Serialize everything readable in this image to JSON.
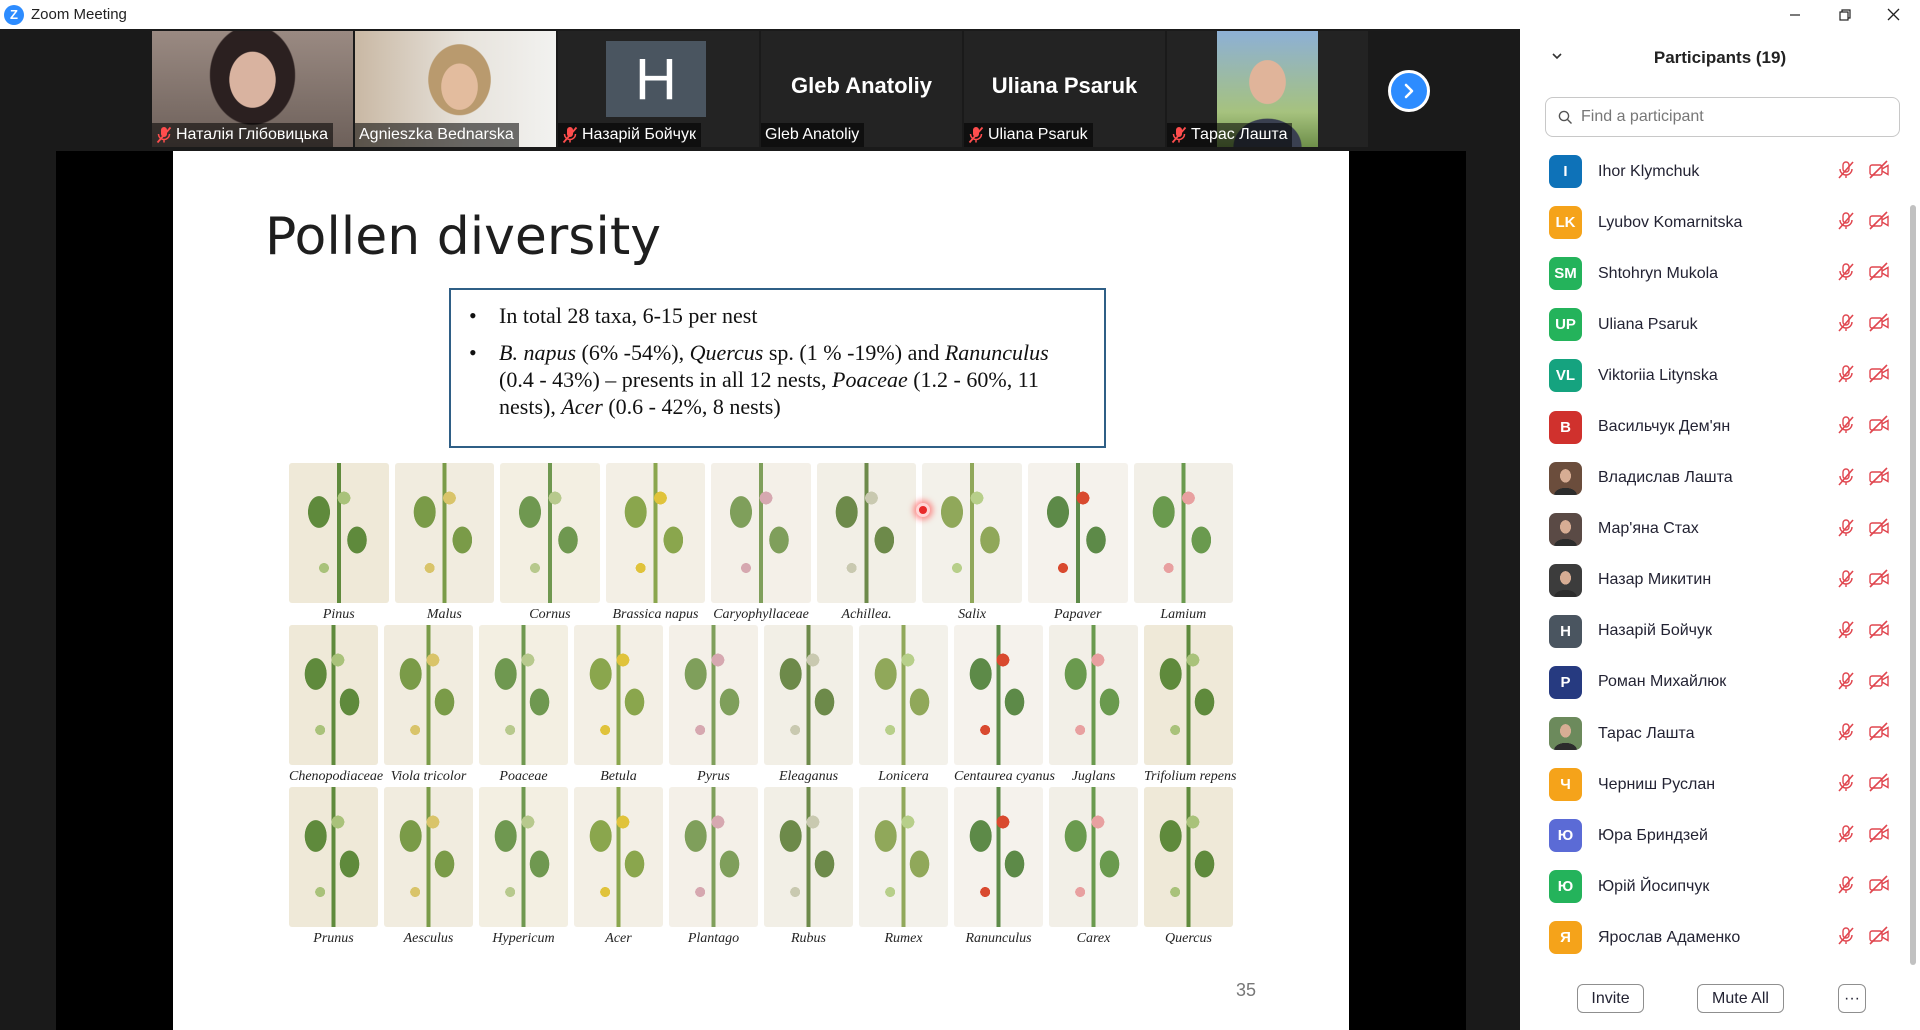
{
  "window": {
    "title": "Zoom Meeting"
  },
  "videos": [
    {
      "name": "Наталія Глібовицька",
      "muted": true,
      "kind": "photo"
    },
    {
      "name": "Agnieszka Bednarska",
      "muted": false,
      "kind": "photo",
      "active": true
    },
    {
      "name": "Назарій Бойчук",
      "muted": true,
      "kind": "avatar",
      "initial": "H"
    },
    {
      "name": "Gleb Anatoliy",
      "muted": false,
      "kind": "name",
      "display": "Gleb Anatoliy"
    },
    {
      "name": "Uliana Psaruk",
      "muted": true,
      "kind": "name",
      "display": "Uliana Psaruk"
    },
    {
      "name": "Тарас Лашта",
      "muted": true,
      "kind": "photo"
    }
  ],
  "slide": {
    "title": "Pollen diversity",
    "bullet1": "In total 28 taxa, 6-15 per nest",
    "b2_i1": "B. napus",
    "b2_t1": " (6% -54%), ",
    "b2_i2": "Quercus",
    "b2_t2": " sp. (1 % -19%) and ",
    "b2_i3": "Ranunculus",
    "b2_t3": " (0.4 - 43%) – presents in all 12 nests, ",
    "b2_i4": "Poaceae",
    "b2_t4": " (1.2 - 60%, 11 nests), ",
    "b2_i5": "Acer",
    "b2_t5": " (0.6 - 42%, 8 nests)",
    "page_number": "35",
    "plants_row1": [
      "Pinus",
      "Malus",
      "Cornus",
      "Brassica napus",
      "Caryophyllaceae",
      "Achillea.",
      "Salix",
      "Papaver",
      "Lamium"
    ],
    "plants_row2": [
      "Chenopodiaceae",
      "Viola tricolor",
      "Poaceae",
      "Betula",
      "Pyrus",
      "Eleaganus",
      "Lonicera",
      "Centaurea cyanus",
      "Juglans",
      "Trifolium repens"
    ],
    "plants_row3": [
      "Prunus",
      "Aesculus",
      "Hypericum",
      "Acer",
      "Plantago",
      "Rubus",
      "Rumex",
      "Ranunculus",
      "Carex",
      "Quercus"
    ]
  },
  "panel": {
    "title": "Participants (19)",
    "search_placeholder": "Find a participant",
    "invite_label": "Invite",
    "mute_all_label": "Mute All",
    "more_label": "···",
    "participants": [
      {
        "name": "Ihor Klymchuk",
        "initials": "I",
        "color": "#0e72b8"
      },
      {
        "name": "Lyubov Komarnitska",
        "initials": "LK",
        "color": "#f5a31a"
      },
      {
        "name": "Shtohryn Mukola",
        "initials": "SM",
        "color": "#24b35b"
      },
      {
        "name": "Uliana Psaruk",
        "initials": "UP",
        "color": "#24b35b"
      },
      {
        "name": "Viktoriia Litynska",
        "initials": "VL",
        "color": "#15a37f"
      },
      {
        "name": "Васильчук Дем'ян",
        "initials": "B",
        "color": "#d0312d"
      },
      {
        "name": "Владислав Лашта",
        "initials": "",
        "color": "#6b4d3c"
      },
      {
        "name": "Мар'яна Стах",
        "initials": "",
        "color": "#5a4a45"
      },
      {
        "name": "Назар Микитин",
        "initials": "",
        "color": "#3c3c3c"
      },
      {
        "name": "Назарій Бойчук",
        "initials": "H",
        "color": "#4a5560"
      },
      {
        "name": "Роман Михайлюк",
        "initials": "P",
        "color": "#263a80"
      },
      {
        "name": "Тарас Лашта",
        "initials": "",
        "color": "#6c8a5c"
      },
      {
        "name": "Черниш Руслан",
        "initials": "Ч",
        "color": "#f5a31a"
      },
      {
        "name": "Юра Бриндзей",
        "initials": "Ю",
        "color": "#5b6bd6"
      },
      {
        "name": "Юрій Йосипчук",
        "initials": "Ю",
        "color": "#24b35b"
      },
      {
        "name": "Ярослав Адаменко",
        "initials": "Я",
        "color": "#f5a31a"
      }
    ]
  }
}
